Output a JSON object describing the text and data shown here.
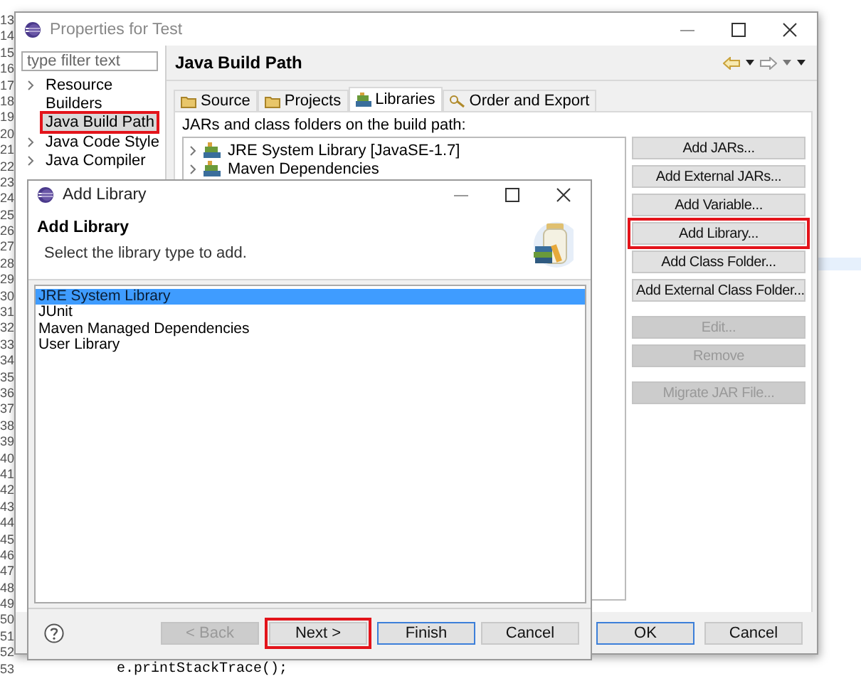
{
  "editor": {
    "lines": [
      {
        "number": "13",
        "current": false
      },
      {
        "number": "14",
        "current": false
      },
      {
        "number": "15",
        "current": false
      },
      {
        "number": "16",
        "current": false
      },
      {
        "number": "17",
        "current": false
      },
      {
        "number": "18",
        "current": false
      },
      {
        "number": "19",
        "current": false
      },
      {
        "number": "20",
        "current": false
      },
      {
        "number": "21",
        "current": false
      },
      {
        "number": "22",
        "current": false
      },
      {
        "number": "23",
        "current": false
      },
      {
        "number": "24",
        "current": false
      },
      {
        "number": "25",
        "current": false
      },
      {
        "number": "26",
        "current": false
      },
      {
        "number": "27",
        "current": false
      },
      {
        "number": "28",
        "current": true
      },
      {
        "number": "29",
        "current": false
      },
      {
        "number": "30",
        "current": false
      },
      {
        "number": "31",
        "current": false
      },
      {
        "number": "32",
        "current": false
      },
      {
        "number": "33",
        "current": false
      },
      {
        "number": "34",
        "current": false
      },
      {
        "number": "35",
        "current": false
      },
      {
        "number": "36",
        "current": false
      },
      {
        "number": "37",
        "current": false
      },
      {
        "number": "38",
        "current": false
      },
      {
        "number": "39",
        "current": false
      },
      {
        "number": "40",
        "current": false
      },
      {
        "number": "41",
        "current": false
      },
      {
        "number": "42",
        "current": false
      },
      {
        "number": "43",
        "current": false
      },
      {
        "number": "44",
        "current": false
      },
      {
        "number": "45",
        "current": false
      },
      {
        "number": "46",
        "current": false
      },
      {
        "number": "47",
        "current": false
      },
      {
        "number": "48",
        "current": false
      },
      {
        "number": "49",
        "current": false
      },
      {
        "number": "50",
        "current": false
      },
      {
        "number": "51",
        "current": false
      },
      {
        "number": "52",
        "current": false
      },
      {
        "number": "53",
        "current": false,
        "code": "            e.printStackTrace();"
      }
    ]
  },
  "properties_window": {
    "title": "Properties for Test",
    "filter": {
      "placeholder": "type filter text"
    },
    "tree": [
      {
        "label": "Resource",
        "expandable": true,
        "selected": false,
        "highlighted": false
      },
      {
        "label": "Builders",
        "expandable": false,
        "selected": false,
        "highlighted": false
      },
      {
        "label": "Java Build Path",
        "expandable": false,
        "selected": true,
        "highlighted": true
      },
      {
        "label": "Java Code Style",
        "expandable": true,
        "selected": false,
        "highlighted": false
      },
      {
        "label": "Java Compiler",
        "expandable": true,
        "selected": false,
        "highlighted": false
      }
    ],
    "page_title": "Java Build Path",
    "tabs": [
      {
        "label": "Source",
        "selected": false
      },
      {
        "label": "Projects",
        "selected": false
      },
      {
        "label": "Libraries",
        "selected": true
      },
      {
        "label": "Order and Export",
        "selected": false
      }
    ],
    "list_label": "JARs and class folders on the build path:",
    "libraries": [
      {
        "label": "JRE System Library [JavaSE-1.7]"
      },
      {
        "label": "Maven Dependencies"
      }
    ],
    "button_groups": [
      [
        {
          "label": "Add JARs...",
          "disabled": false,
          "highlighted": false
        },
        {
          "label": "Add External JARs...",
          "disabled": false,
          "highlighted": false
        },
        {
          "label": "Add Variable...",
          "disabled": false,
          "highlighted": false
        },
        {
          "label": "Add Library...",
          "disabled": false,
          "highlighted": true
        },
        {
          "label": "Add Class Folder...",
          "disabled": false,
          "highlighted": false
        },
        {
          "label": "Add External Class Folder...",
          "disabled": false,
          "highlighted": false
        }
      ],
      [
        {
          "label": "Edit...",
          "disabled": true,
          "highlighted": false
        },
        {
          "label": "Remove",
          "disabled": true,
          "highlighted": false
        }
      ],
      [
        {
          "label": "Migrate JAR File...",
          "disabled": true,
          "highlighted": false
        }
      ]
    ],
    "footer_buttons": [
      {
        "label": "OK",
        "default": true
      },
      {
        "label": "Cancel",
        "default": false
      }
    ]
  },
  "add_library_dialog": {
    "title": "Add Library",
    "heading": "Add Library",
    "description": "Select the library type to add.",
    "items": [
      {
        "label": "JRE System Library",
        "selected": true
      },
      {
        "label": "JUnit",
        "selected": false
      },
      {
        "label": "Maven Managed Dependencies",
        "selected": false
      },
      {
        "label": "User Library",
        "selected": false
      }
    ],
    "buttons": [
      {
        "label": "< Back",
        "disabled": true,
        "default": false,
        "highlighted": false
      },
      {
        "label": "Next >",
        "disabled": false,
        "default": false,
        "highlighted": true
      },
      {
        "label": "Finish",
        "disabled": false,
        "default": true,
        "highlighted": false
      },
      {
        "label": "Cancel",
        "disabled": false,
        "default": false,
        "highlighted": false
      }
    ]
  }
}
